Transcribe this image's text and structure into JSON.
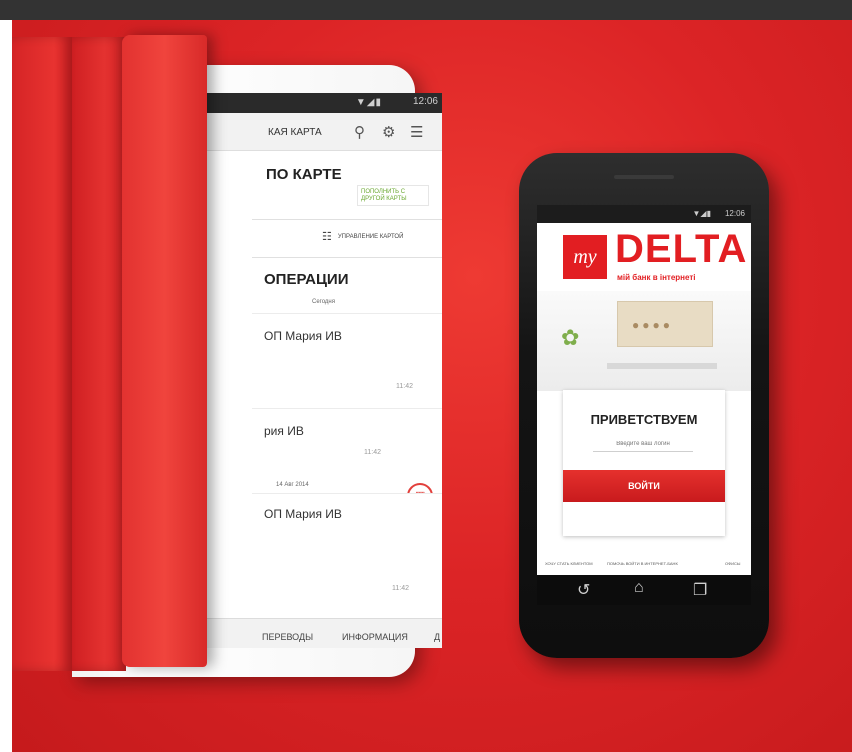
{
  "tablet": {
    "status_time": "12:06",
    "status_signal": "▼◢▮",
    "appbar_title": "КАЯ КАРТА",
    "section_card": "ПО КАРТЕ",
    "pay_label": "ПОПОЛНИТЬ С ДРУГОЙ КАРТЫ",
    "manage_label": "УПРАВЛЕНИЕ КАРТОЙ",
    "section_ops": "ОПЕРАЦИИ",
    "date_today": "Сегодня",
    "op1_name": "ОП Мария ИВ",
    "op1_time": "11:42",
    "op2_name": "рия ИВ",
    "op2_time": "11:42",
    "date_2": "14 Авг 2014",
    "op3_name": "ОП Мария ИВ",
    "op3_time": "11:42",
    "tabs": [
      "ПЕРЕВОДЫ",
      "ИНФОРМАЦИЯ",
      "Д"
    ]
  },
  "phone": {
    "status_time": "12:06",
    "status_signal": "▼◢▮",
    "logo_mark": "my",
    "logo_name": "DELTA",
    "logo_tagline": "мій банк в інтернеті",
    "greeting": "ПРИВЕТСТВУЕМ",
    "login_placeholder": "Введите ваш логин",
    "login_button": "ВОЙТИ",
    "footer_links": [
      "ХОЧУ СТАТЬ КЛИЕНТОМ",
      "ПОМОЧЬ ВОЙТИ В ИНТЕРНЕТ-БАНК",
      "ОФИСЫ"
    ]
  },
  "colors": {
    "brand_red": "#e21e22",
    "background_red": "#dc2426",
    "accent_green": "#6aa830"
  },
  "icons": {
    "tablet_appbar": [
      "search-icon",
      "gear-icon",
      "menu-icon"
    ],
    "tablet_manage": "card-settings-icon",
    "tablet_fab": "document-icon",
    "tablet_nav": [
      "home-icon",
      "recent-apps-icon"
    ],
    "phone_nav": [
      "back-icon",
      "home-icon",
      "recent-apps-icon"
    ]
  }
}
